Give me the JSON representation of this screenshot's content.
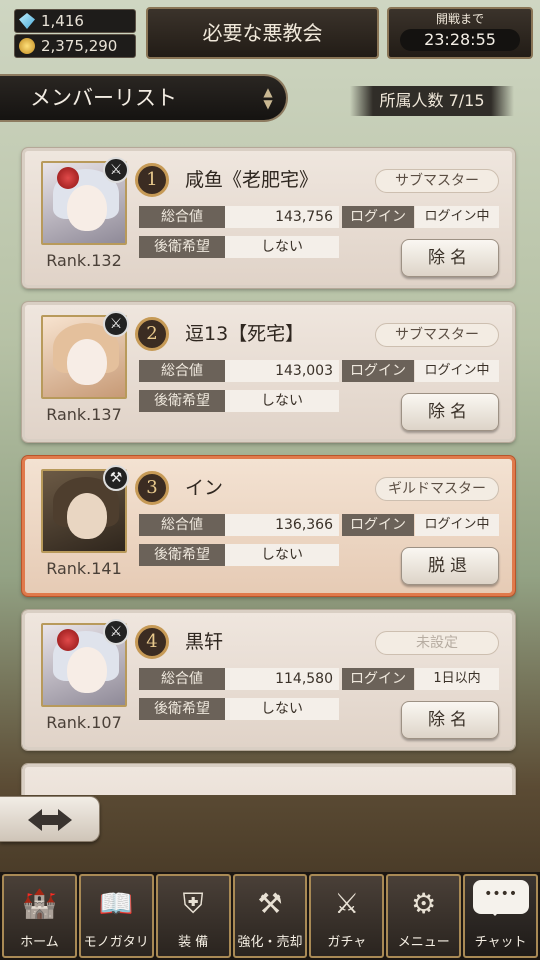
{
  "top": {
    "gems": "1,416",
    "gold": "2,375,290",
    "guild_name": "必要な悪教会",
    "timer_label": "開戦まで",
    "timer_value": "23:28:55"
  },
  "header": {
    "title": "メンバーリスト",
    "member_count": "所属人数 7/15"
  },
  "labels": {
    "total": "総合値",
    "rear": "後衛希望",
    "login": "ログイン"
  },
  "members": [
    {
      "rank_num": "1",
      "name": "咸鱼《老肥宅》",
      "role": "サブマスター",
      "total": "143,756",
      "login": "ログイン中",
      "rear": "しない",
      "action": "除名",
      "player_rank": "Rank.132"
    },
    {
      "rank_num": "2",
      "name": "逗13【死宅】",
      "role": "サブマスター",
      "total": "143,003",
      "login": "ログイン中",
      "rear": "しない",
      "action": "除名",
      "player_rank": "Rank.137"
    },
    {
      "rank_num": "3",
      "name": "イン",
      "role": "ギルドマスター",
      "total": "136,366",
      "login": "ログイン中",
      "rear": "しない",
      "action": "脱退",
      "player_rank": "Rank.141"
    },
    {
      "rank_num": "4",
      "name": "黒轩",
      "role": "未設定",
      "total": "114,580",
      "login": "1日以内",
      "rear": "しない",
      "action": "除名",
      "player_rank": "Rank.107"
    }
  ],
  "nav": [
    {
      "label": "ホーム",
      "icon": "castle-icon"
    },
    {
      "label": "モノガタリ",
      "icon": "book-icon"
    },
    {
      "label": "装 備",
      "icon": "armor-icon"
    },
    {
      "label": "強化・売却",
      "icon": "anvil-icon"
    },
    {
      "label": "ガチャ",
      "icon": "crossed-swords-icon"
    },
    {
      "label": "メニュー",
      "icon": "gears-icon"
    },
    {
      "label": "チャット",
      "icon": "chat-bubble-icon"
    }
  ]
}
